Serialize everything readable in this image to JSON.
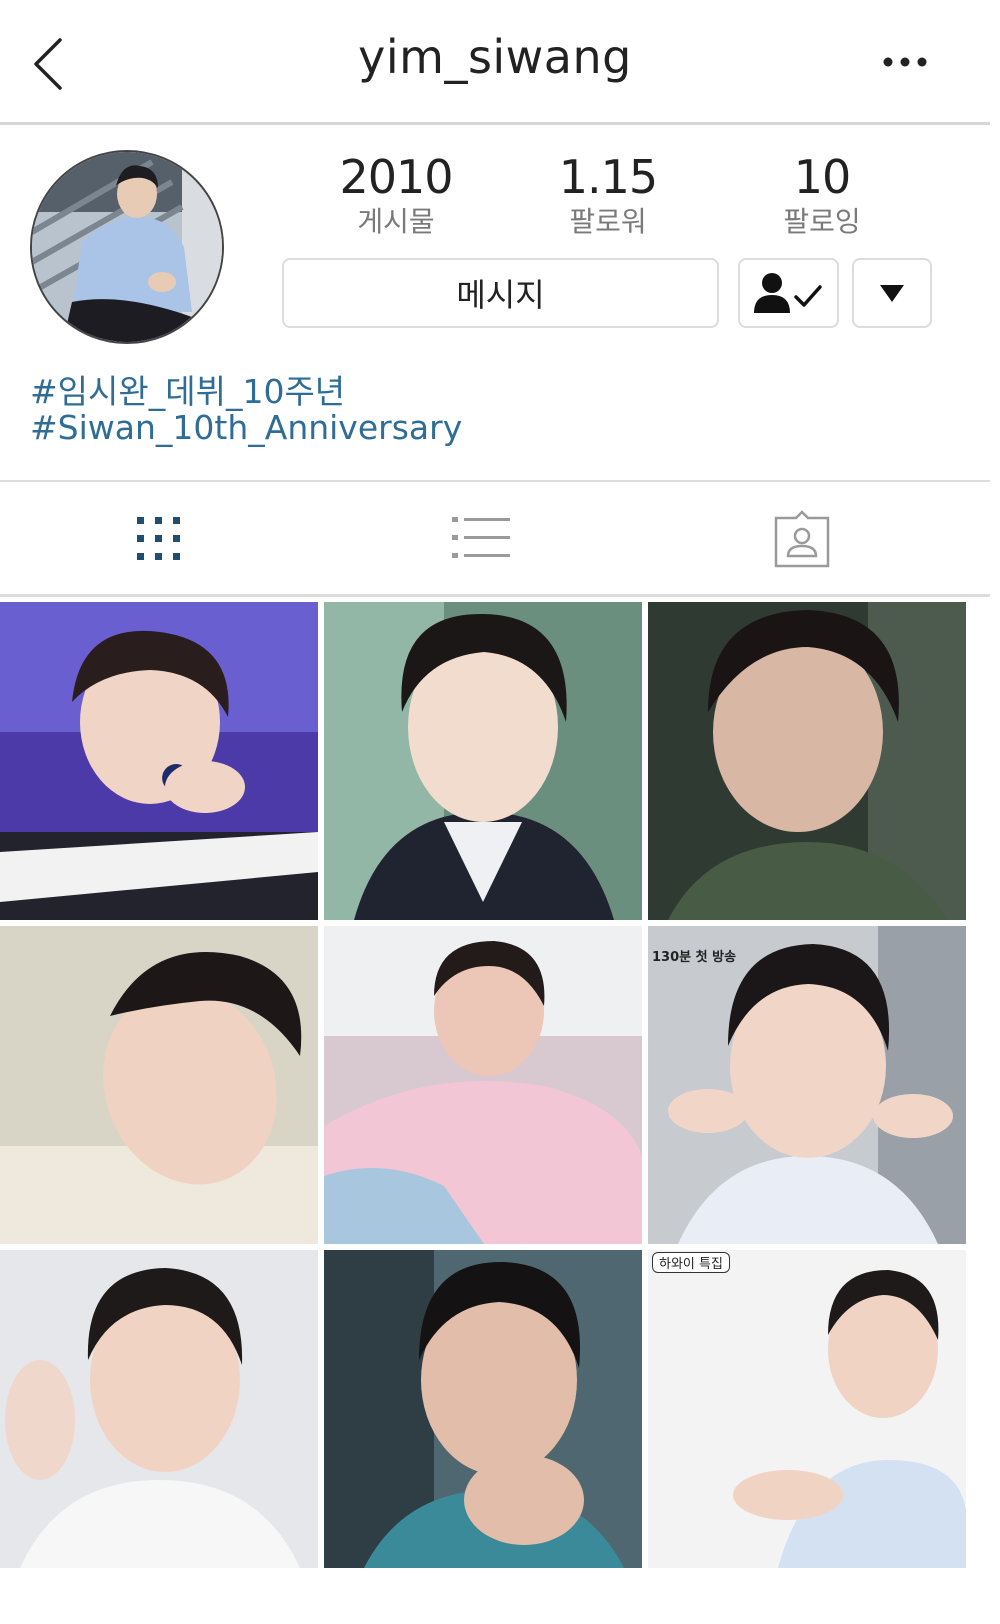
{
  "header": {
    "username": "yim_siwang",
    "back_icon": "chevron-left-icon",
    "more_icon": "more-horizontal-icon"
  },
  "profile": {
    "avatar_icon": "profile-photo",
    "stats": [
      {
        "value": "2010",
        "label": "게시물"
      },
      {
        "value": "1.15",
        "label": "팔로워"
      },
      {
        "value": "10",
        "label": "팔로잉"
      }
    ],
    "message_button": "메시지",
    "follow_icon": "user-check-icon",
    "dropdown_icon": "caret-down-icon",
    "bio": [
      "#임시완_데뷔_10주년",
      "#Siwan_10th_Anniversary"
    ]
  },
  "tabs": [
    {
      "icon": "grid-icon",
      "active": true
    },
    {
      "icon": "list-icon",
      "active": false
    },
    {
      "icon": "tagged-user-icon",
      "active": false
    }
  ],
  "posts": [
    {
      "bg": "#4b3aa8",
      "caption": ""
    },
    {
      "bg": "#6b8f7e",
      "caption": ""
    },
    {
      "bg": "#2f3a32",
      "caption": ""
    },
    {
      "bg": "#d8d4c6",
      "caption": ""
    },
    {
      "bg": "#d7c9cf",
      "caption": ""
    },
    {
      "bg": "#c7cbd0",
      "caption": "130분 첫 방송"
    },
    {
      "bg": "#e6e7ea",
      "caption": ""
    },
    {
      "bg": "#4f6770",
      "caption": ""
    },
    {
      "bg": "#f3f3f3",
      "caption": "하와이 특집"
    }
  ],
  "colors": {
    "link": "#2f6d96",
    "active_tab": "#1f4e6e",
    "inactive_tab": "#9a9a9a",
    "divider": "#dddddd"
  }
}
